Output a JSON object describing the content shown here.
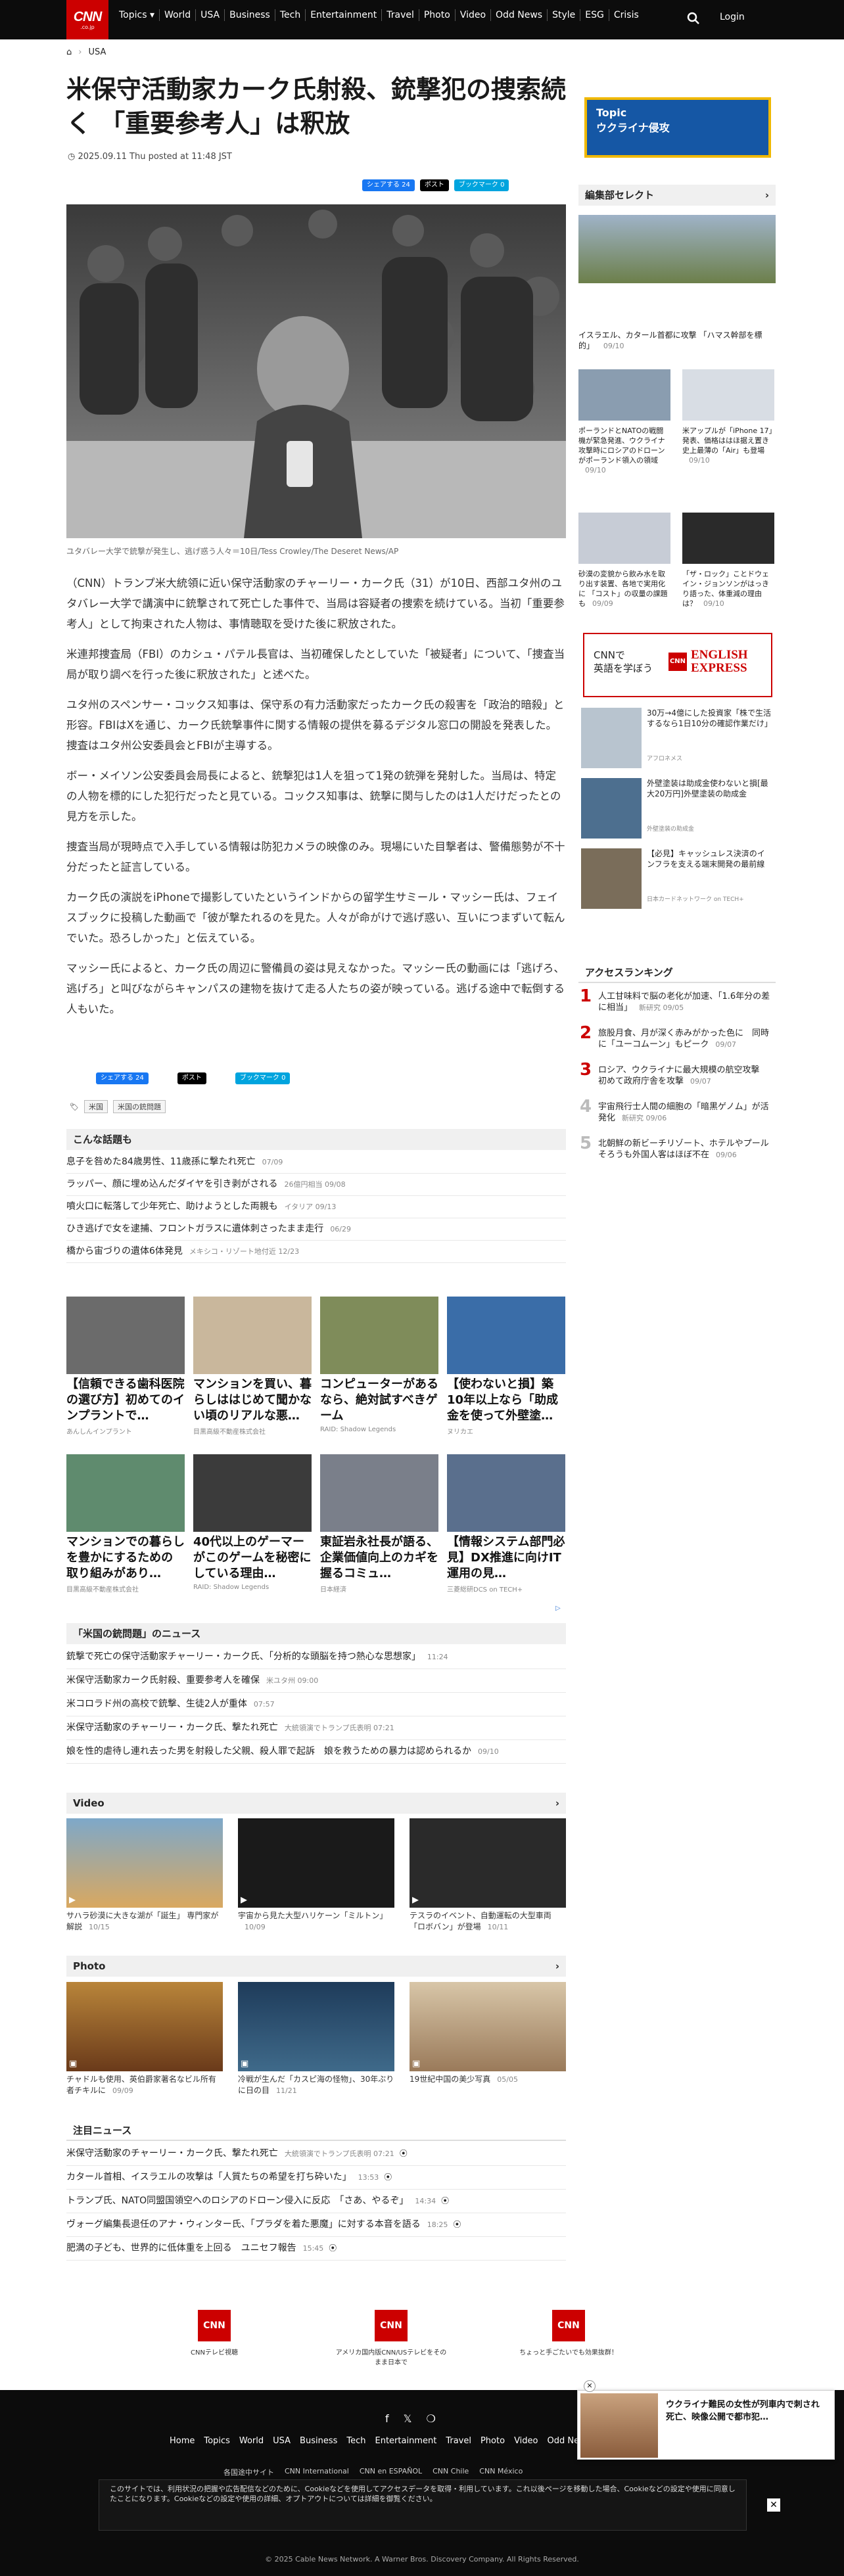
{
  "header": {
    "logo": "CNN",
    "logo_sub": ".co.jp",
    "nav": [
      "Topics ▾",
      "World",
      "USA",
      "Business",
      "Tech",
      "Entertainment",
      "Travel",
      "Photo",
      "Video",
      "Odd News",
      "Style",
      "ESG",
      "Crisis"
    ],
    "login": "Login"
  },
  "breadcrumb": {
    "home": "⌂",
    "section": "USA"
  },
  "article": {
    "title": "米保守活動家カーク氏射殺、銃撃犯の捜索続く 「重要参考人」は釈放",
    "date": "2025.09.11 Thu posted at 11:48 JST",
    "share": {
      "fb": "シェアする 24",
      "x": "ポスト",
      "hb": "ブックマーク 0"
    },
    "caption": "ユタバレー大学で銃撃が発生し、逃げ惑う人々＝10日/Tess Crowley/The Deseret News/AP",
    "paragraphs": [
      "（CNN）トランプ米大統領に近い保守活動家のチャーリー・カーク氏（31）が10日、西部ユタ州のユタバレー大学で講演中に銃撃されて死亡した事件で、当局は容疑者の捜索を続けている。当初「重要参考人」として拘束された人物は、事情聴取を受けた後に釈放された。",
      "米連邦捜査局（FBI）のカシュ・パテル長官は、当初確保したとしていた「被疑者」について、「捜査当局が取り調べを行った後に釈放された」と述べた。",
      "ユタ州のスペンサー・コックス知事は、保守系の有力活動家だったカーク氏の殺害を「政治的暗殺」と形容。FBIはXを通じ、カーク氏銃撃事件に関する情報の提供を募るデジタル窓口の開設を発表した。捜査はユタ州公安委員会とFBIが主導する。",
      "ボー・メイソン公安委員会局長によると、銃撃犯は1人を狙って1発の銃弾を発射した。当局は、特定の人物を標的にした犯行だったと見ている。コックス知事は、銃撃に関与したのは1人だけだったとの見方を示した。",
      "捜査当局が現時点で入手している情報は防犯カメラの映像のみ。現場にいた目撃者は、警備態勢が不十分だったと証言している。",
      "カーク氏の演説をiPhoneで撮影していたというインドからの留学生サミール・マッシー氏は、フェイスブックに投稿した動画で「彼が撃たれるのを見た。人々が命がけで逃げ惑い、互いにつまずいて転んでいた。恐ろしかった」と伝えている。",
      "マッシー氏によると、カーク氏の周辺に警備員の姿は見えなかった。マッシー氏の動画には「逃げろ、逃げろ」と叫びながらキャンパスの建物を抜けて走る人たちの姿が映っている。逃げる途中で転倒する人もいた。"
    ],
    "share_bottom": {
      "fb": "シェアする 24",
      "x": "ポスト",
      "hb": "ブックマーク 0"
    },
    "tags": [
      "米国",
      "米国の銃問題"
    ]
  },
  "related": {
    "title": "こんな話題も",
    "items": [
      {
        "t": "息子を咎めた84歳男性、11歳孫に撃たれ死亡",
        "d": "07/09"
      },
      {
        "t": "ラッパー、顔に埋め込んだダイヤを引き剥がされる",
        "d": "26億円相当  09/08"
      },
      {
        "t": "噴火口に転落して少年死亡、助けようとした両親も",
        "d": "イタリア  09/13"
      },
      {
        "t": "ひき逃げで女を逮捕、フロントガラスに遺体刺さったまま走行",
        "d": "06/29"
      },
      {
        "t": "橋から宙づりの遺体6体発見",
        "d": "メキシコ・リゾート地付近  12/23"
      }
    ]
  },
  "ads": [
    {
      "t": "【信頼できる歯科医院の選び方】初めてのインプラントで…",
      "s": "あんしんインプラント"
    },
    {
      "t": "マンションを買い、暮らしははじめて聞かない頃のリアルな悪…",
      "s": "目黒高級不動産株式会社"
    },
    {
      "t": "コンピューターがあるなら、絶対試すべきゲーム",
      "s": "RAID: Shadow Legends"
    },
    {
      "t": "【使わないと損】築10年以上なら「助成金を使って外壁塗…",
      "s": "ヌリカエ"
    },
    {
      "t": "マンションでの暮らしを豊かにするための取り組みがあり…",
      "s": "目黒高級不動産株式会社"
    },
    {
      "t": "40代以上のゲーマーがこのゲームを秘密にしている理由…",
      "s": "RAID: Shadow Legends"
    },
    {
      "t": "東証岩永社長が語る、企業価値向上のカギを握るコミュ…",
      "s": "日本経済"
    },
    {
      "t": "【情報システム部門必見】DX推進に向けIT運用の見…",
      "s": "三菱総研DCS on TECH+"
    }
  ],
  "gun": {
    "title": "「米国の銃問題」のニュース",
    "items": [
      {
        "t": "銃撃で死亡の保守活動家チャーリー・カーク氏、「分析的な頭脳を持つ熱心な思想家」",
        "d": "11:24"
      },
      {
        "t": "米保守活動家カーク氏射殺、重要参考人を確保",
        "d": "米ユタ州  09:00"
      },
      {
        "t": "米コロラド州の高校で銃撃、生徒2人が重体",
        "d": "07:57"
      },
      {
        "t": "米保守活動家のチャーリー・カーク氏、撃たれ死亡",
        "d": "大統領演でトランプ氏表明  07:21"
      },
      {
        "t": "娘を性的虐待し連れ去った男を射殺した父親、殺人罪で起訴　娘を救うための暴力は認められるか",
        "d": "09/10"
      }
    ]
  },
  "video": {
    "title": "Video",
    "items": [
      {
        "t": "サハラ砂漠に大きな湖が「誕生」 専門家が解説",
        "d": "10/15"
      },
      {
        "t": "宇宙から見た大型ハリケーン「ミルトン」",
        "d": "10/09"
      },
      {
        "t": "テスラのイベント、自動運転の大型車両「ロボバン」が登場",
        "d": "10/11"
      }
    ]
  },
  "photo": {
    "title": "Photo",
    "items": [
      {
        "t": "チャドルも使用、英伯爵家著名なビル所有者チキルに",
        "d": "09/09"
      },
      {
        "t": "冷戦が生んだ「カスピ海の怪物」、30年ぶりに日の目",
        "d": "11/21"
      },
      {
        "t": "19世紀中国の美少写真",
        "d": "05/05"
      }
    ]
  },
  "notable": {
    "title": "注目ニュース",
    "items": [
      {
        "t": "米保守活動家のチャーリー・カーク氏、撃たれ死亡",
        "d": "大統領演でトランプ氏表明  07:21"
      },
      {
        "t": "カタール首相、イスラエルの攻撃は「人質たちの希望を打ち砕いた」",
        "d": "13:53"
      },
      {
        "t": "トランプ氏、NATO同盟国領空へのロシアのドローン侵入に反応　「さあ、やるぞ」",
        "d": "14:34"
      },
      {
        "t": "ヴォーグ編集長退任のアナ・ウィンター氏、「プラダを着た悪魔」に対する本音を語る",
        "d": "18:25"
      },
      {
        "t": "肥満の子ども、世界的に低体重を上回る　ユニセフ報告",
        "d": "15:45"
      }
    ]
  },
  "promos": [
    {
      "t": "CNNテレビ視聴"
    },
    {
      "t": "アメリカ国内版CNN/USテレビをそのまま日本で"
    },
    {
      "t": "ちょっと手ごたいでも効果抜群！"
    }
  ],
  "sidebar": {
    "topic": {
      "label": "Topic",
      "name": "ウクライナ侵攻"
    },
    "editors": {
      "title": "編集部セレクト",
      "main": "イスラエル、カタール首都に攻撃 「ハマス幹部を標的」",
      "main_d": "09/10",
      "items": [
        {
          "t": "ポーランドとNATOの戦闘機が緊急発進、ウクライナ攻撃時にロシアのドローンがポーランド領入の領域",
          "d": "09/10"
        },
        {
          "t": "米アップルが「iPhone 17」発表、価格ははほ据え置き　史上最薄の「Air」も登場",
          "d": "09/10"
        },
        {
          "t": "砂漠の変貌から飲み水を取り出す装置、各地で実用化に 「コスト」の収量の課題も",
          "d": "09/09"
        },
        {
          "t": "「ザ・ロック」ことドウェイン・ジョンソンがはっきり語った、体重減の理由は？",
          "d": "09/10"
        }
      ]
    },
    "english": {
      "a": "CNNで",
      "b": "英語を学ぼう",
      "brand": "ENGLISH EXPRESS"
    },
    "ads": [
      {
        "t": "30万→4億にした投資家「株で生活するなら1日10分の確認作業だけ」",
        "s": "アフロネメス"
      },
      {
        "t": "外壁塗装は助成金使わないと損[最大20万円]外壁塗装の助成金",
        "s": "外壁塗装の助成金"
      },
      {
        "t": "【必見】キャッシュレス決済のインフラを支える端末開発の最前線",
        "s": "日本カードネットワーク on TECH+"
      }
    ],
    "ranking": {
      "title": "アクセスランキング",
      "items": [
        {
          "n": "1",
          "t": "人工甘味料で脳の老化が加速、「1.6年分の差に相当」",
          "d": "新研究  09/05"
        },
        {
          "n": "2",
          "t": "旅股月食、月が深く赤みがかった色に　同時に「ユーコムーン」もピーク",
          "d": "09/07"
        },
        {
          "n": "3",
          "t": "ロシア、ウクライナに最大規模の航空攻撃　初めて政府庁舎を攻撃",
          "d": "09/07"
        },
        {
          "n": "4",
          "t": "宇宙飛行士人間の細胞の「暗黒ゲノム」が活発化",
          "d": "新研究  09/06"
        },
        {
          "n": "5",
          "t": "北朝鮮の新ビーチリゾート、ホテルやプールそろうも外国人客はほぼ不在",
          "d": "09/06"
        }
      ]
    }
  },
  "footer": {
    "social": [
      "f",
      "𝕏",
      "❍"
    ],
    "links": [
      "Home",
      "Topics",
      "World",
      "USA",
      "Business",
      "Tech",
      "Entertainment",
      "Travel",
      "Photo",
      "Video",
      "Odd News"
    ],
    "editions": [
      "各国途中サイト",
      "CNN International",
      "CNN en ESPAÑOL",
      "CNN Chile",
      "CNN México"
    ],
    "cookie": "このサイトでは、利用状況の把握や広告配信などのために、Cookieなどを使用してアクセスデータを取得・利用しています。これ以後ページを移動した場合、Cookieなどの設定や使用に同意したことになります。Cookieなどの設定や使用の詳細、オプトアウトについては詳細を御覧ください。",
    "copyright": "© 2025 Cable News Network. A Warner Bros. Discovery Company. All Rights Reserved.",
    "popup": "ウクライナ難民の女性が列車内で刺され死亡、映像公開で都市犯…"
  }
}
